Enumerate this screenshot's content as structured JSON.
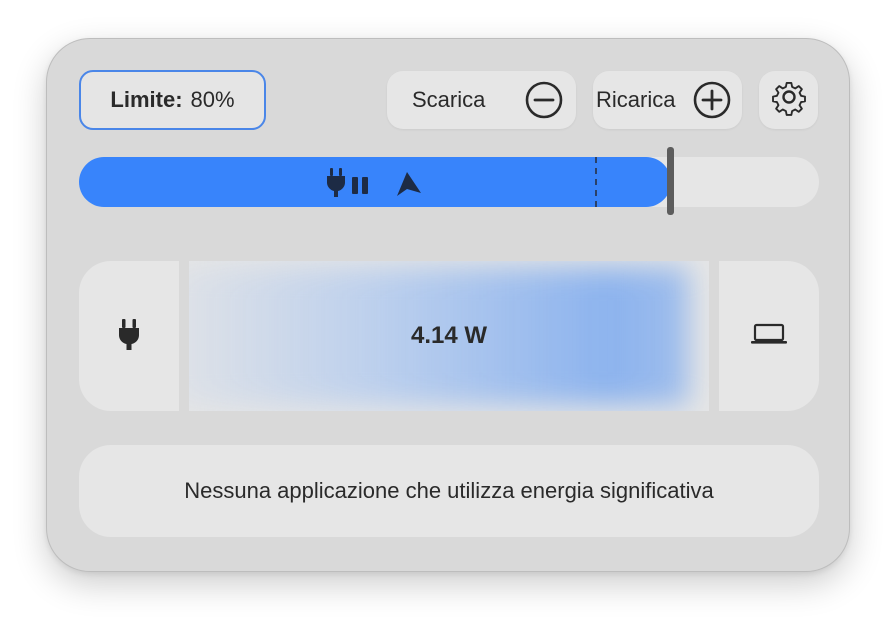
{
  "limit": {
    "label": "Limite:",
    "value": "80%"
  },
  "buttons": {
    "discharge_label": "Scarica",
    "charge_label": "Ricarica"
  },
  "battery_bar": {
    "fill_percent": 80,
    "limit_percent": 80,
    "icons": [
      "plug-pause-icon",
      "location-arrow-icon"
    ]
  },
  "power_flow": {
    "source_icon": "power-plug-icon",
    "watts": "4.14 W",
    "target_icon": "laptop-icon"
  },
  "apps": {
    "message": "Nessuna applicazione che utilizza energia significativa"
  },
  "colors": {
    "accent": "#3884fb",
    "limit_border": "#4a86e8",
    "panel": "#d9d9d9",
    "tile": "#e6e6e6",
    "text": "#2a2a2a"
  }
}
